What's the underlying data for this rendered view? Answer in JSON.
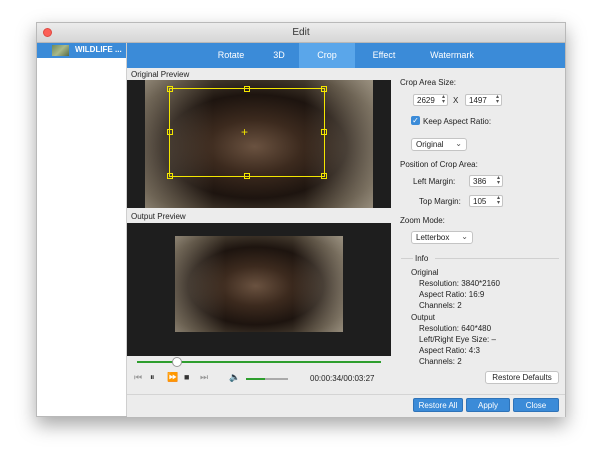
{
  "window": {
    "title": "Edit"
  },
  "sidebar": {
    "items": [
      {
        "label": "WILDLIFE ..."
      }
    ]
  },
  "tabs": [
    {
      "label": "Rotate"
    },
    {
      "label": "3D"
    },
    {
      "label": "Crop",
      "active": true
    },
    {
      "label": "Effect"
    },
    {
      "label": "Watermark"
    }
  ],
  "preview": {
    "original_label": "Original Preview",
    "output_label": "Output Preview"
  },
  "playback": {
    "time": "00:00:34/00:03:27",
    "progress_fraction": 0.16,
    "volume_fraction": 0.45
  },
  "crop": {
    "area_size_label": "Crop Area Size:",
    "width": "2629",
    "x_sep": "X",
    "height": "1497",
    "keep_aspect_label": "Keep Aspect Ratio:",
    "keep_aspect_checked": true,
    "aspect_select": "Original",
    "position_label": "Position of Crop Area:",
    "left_margin_label": "Left Margin:",
    "left_margin": "386",
    "top_margin_label": "Top Margin:",
    "top_margin": "105",
    "zoom_mode_label": "Zoom Mode:",
    "zoom_mode": "Letterbox"
  },
  "info": {
    "heading": "Info",
    "original_heading": "Original",
    "original_resolution": "Resolution: 3840*2160",
    "original_aspect": "Aspect Ratio: 16:9",
    "original_channels": "Channels: 2",
    "output_heading": "Output",
    "output_resolution": "Resolution: 640*480",
    "output_eye_size": "Left/Right Eye Size: –",
    "output_aspect": "Aspect Ratio: 4:3",
    "output_channels": "Channels: 2"
  },
  "buttons": {
    "restore_defaults": "Restore Defaults",
    "restore_all": "Restore All",
    "apply": "Apply",
    "close": "Close"
  },
  "colors": {
    "accent": "#3b8bd8",
    "progress": "#2e9e2e",
    "crop_box": "#f3e600"
  },
  "icons": [
    "close-icon",
    "first-frame-icon",
    "pause-icon",
    "fast-forward-icon",
    "stop-icon",
    "last-frame-icon",
    "volume-icon",
    "chevron-down-icon",
    "checkmark-icon"
  ]
}
